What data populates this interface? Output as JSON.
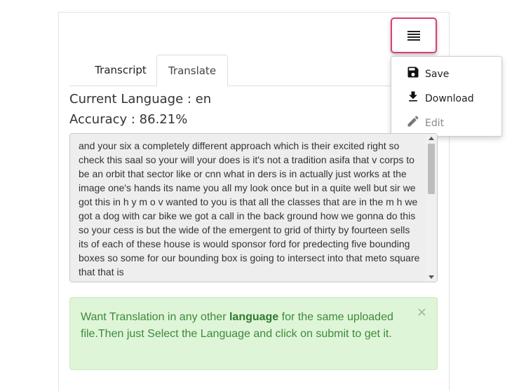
{
  "tabs": [
    {
      "label": "Transcript"
    },
    {
      "label": "Translate"
    }
  ],
  "menu": {
    "items": [
      {
        "label": "Save",
        "icon": "save-icon"
      },
      {
        "label": "Download",
        "icon": "download-icon"
      },
      {
        "label": "Edit",
        "icon": "edit-icon"
      }
    ]
  },
  "info": {
    "language": "Current Language : en",
    "accuracy": "Accuracy : 86.21%"
  },
  "transcript_text": "and your six a completely different approach which is their excited right so check this saal so your will your does is it's not a tradition asifa that v corps to be an orbit that sector like or cnn what in ders is in actually just works at the image one's hands its name you all my look once but in a quite well but sir we got this in h y m o v wanted to you is that all the classes that are in the m h we got a dog with car bike we got a call in the back ground how we gonna do this so your cess is but the wide of the emergent to grid of thirty by fourteen sells its of each of these house is would sponsor ford for predecting five bounding boxes so some for our bounding box is going to intersect into that meto square that that is",
  "alert": {
    "before": "Want Translation in any other ",
    "bold": "language",
    "after": " for the same uploaded file.Then just Select the Language and click on submit to get it.",
    "close": "×"
  },
  "colors": {
    "accent": "#d9406e",
    "alert_bg": "#dff5d8",
    "alert_text": "#3c8a3a"
  }
}
